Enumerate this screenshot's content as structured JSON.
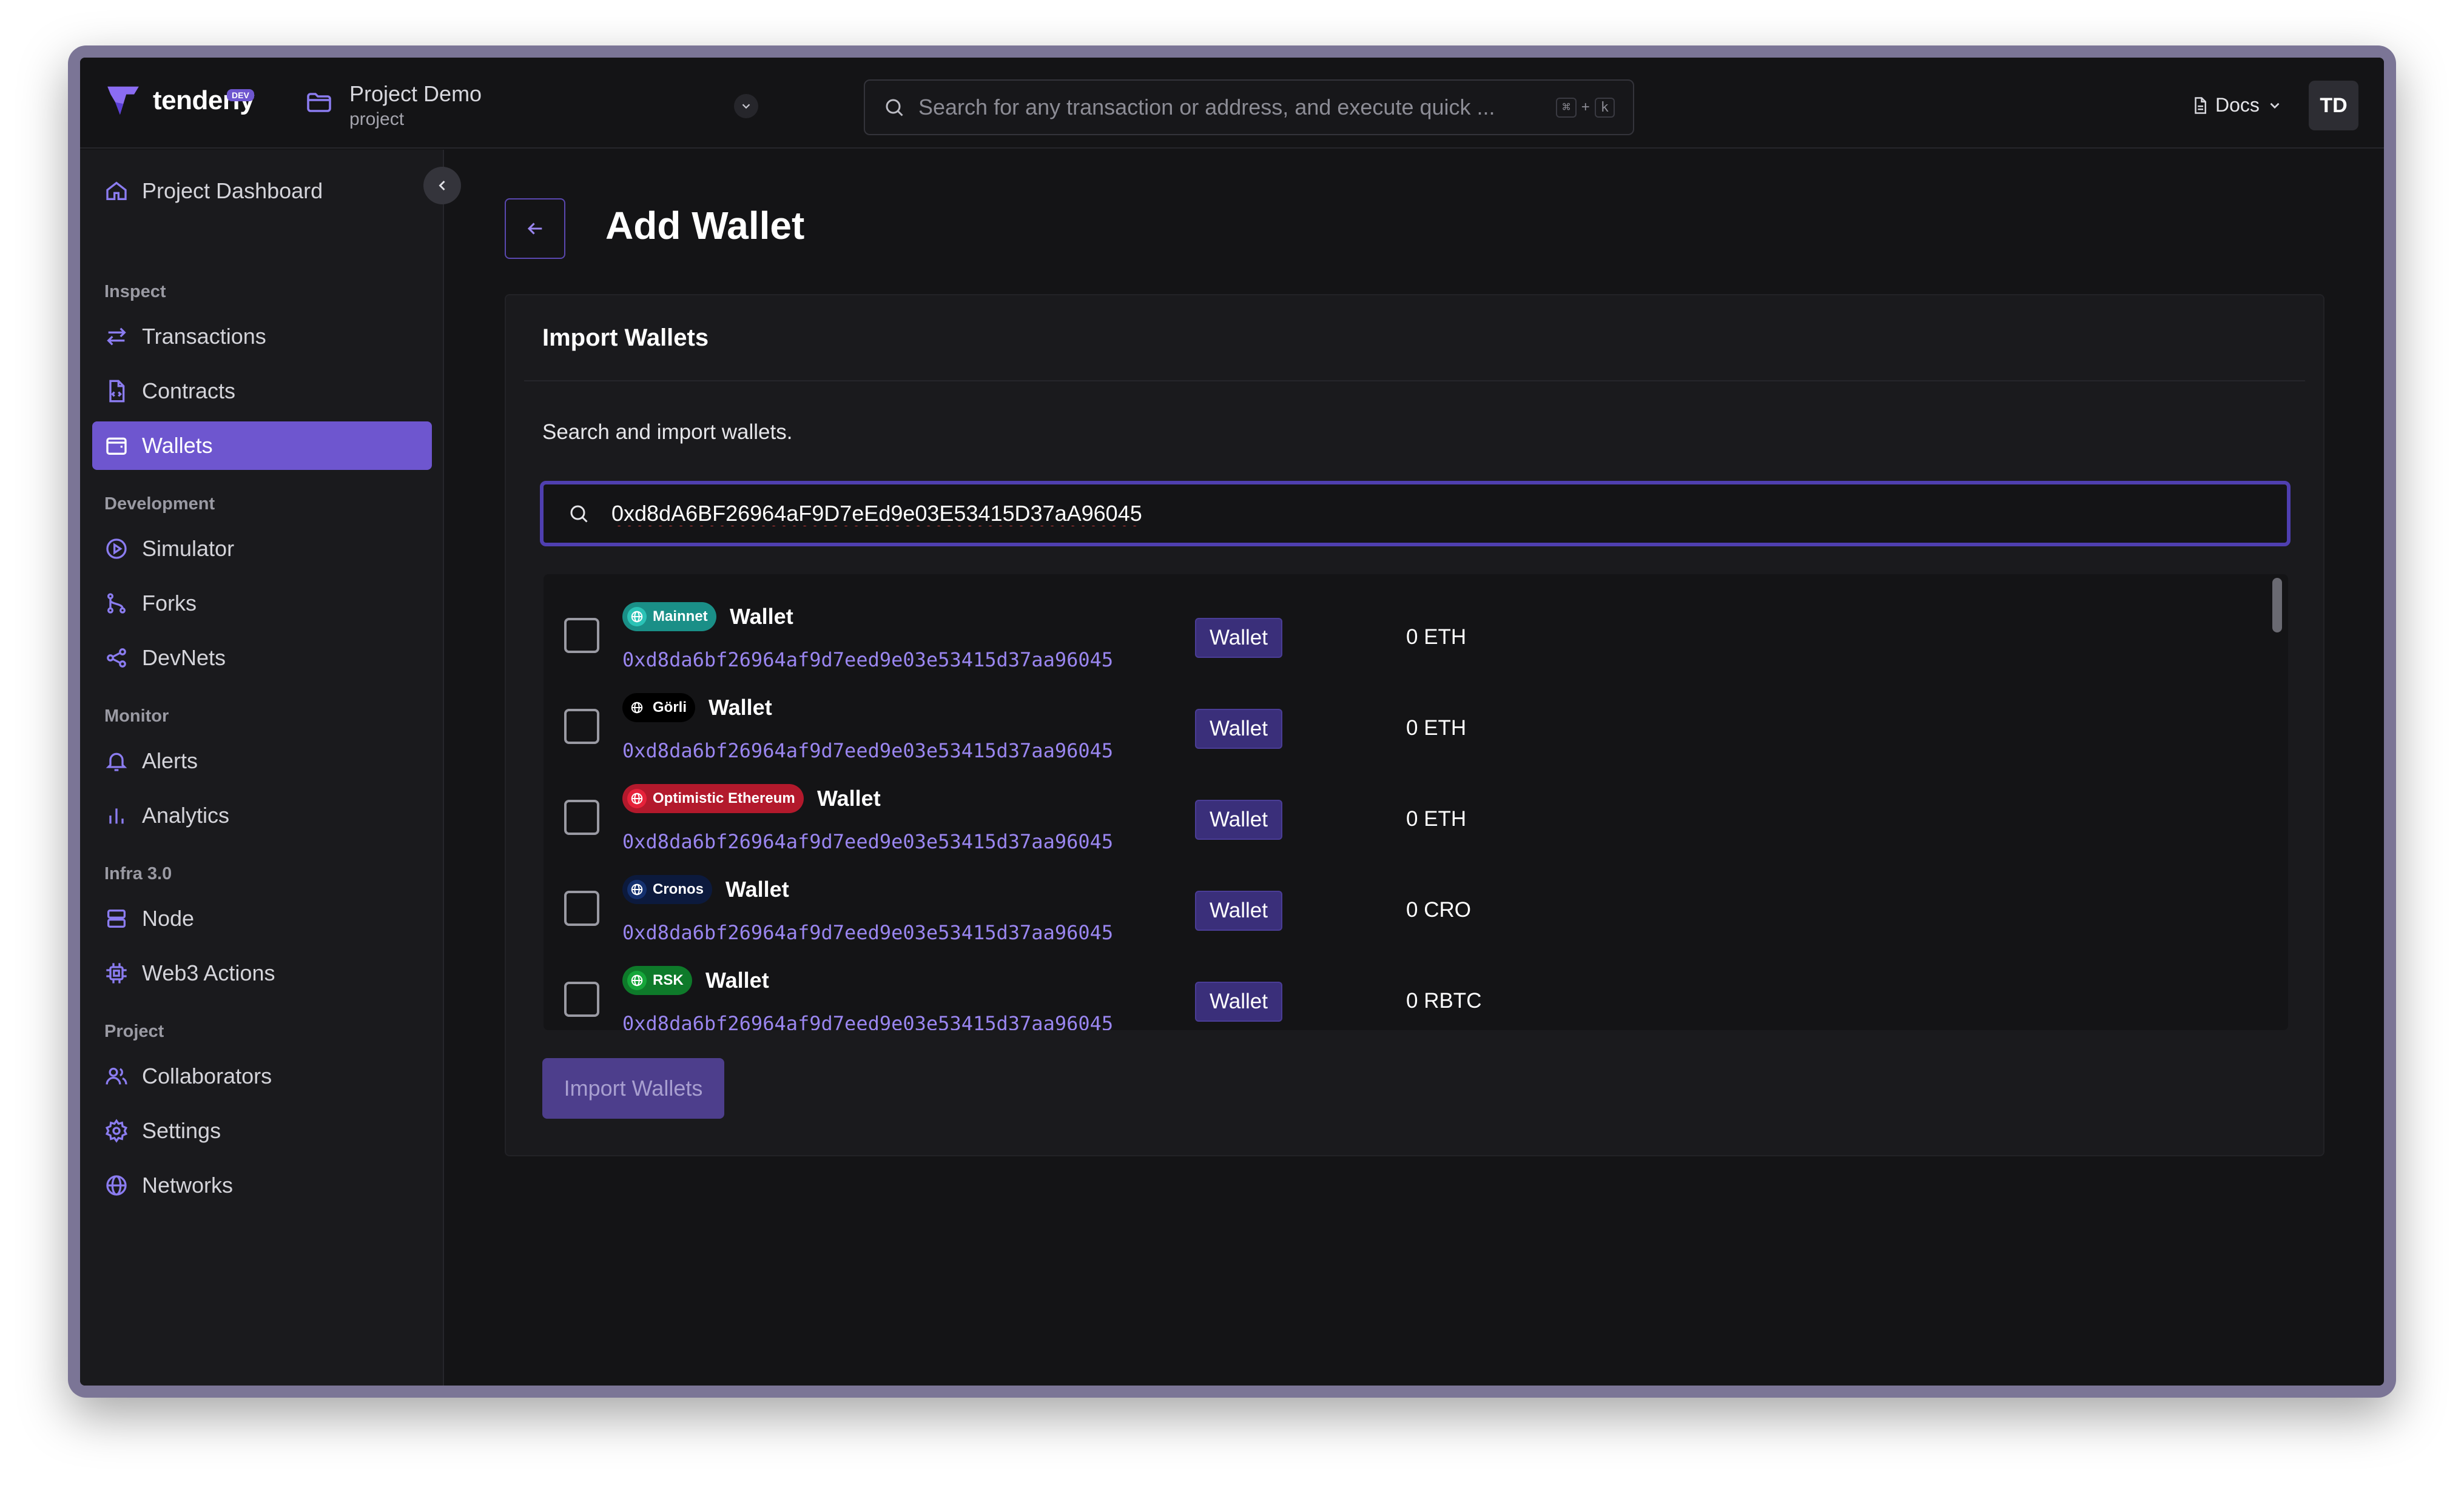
{
  "brand": {
    "name": "tenderly",
    "badge": "DEV"
  },
  "project": {
    "name": "Project Demo",
    "type": "project"
  },
  "search": {
    "placeholder": "Search for any transaction or address, and execute quick ...",
    "shortcut_key1": "⌘",
    "shortcut_plus": "+",
    "shortcut_key2": "k"
  },
  "header": {
    "docs_label": "Docs",
    "avatar_initials": "TD"
  },
  "sidebar": {
    "dashboard": "Project Dashboard",
    "sections": {
      "inspect": "Inspect",
      "development": "Development",
      "monitor": "Monitor",
      "infra": "Infra 3.0",
      "project": "Project"
    },
    "items": {
      "transactions": "Transactions",
      "contracts": "Contracts",
      "wallets": "Wallets",
      "simulator": "Simulator",
      "forks": "Forks",
      "devnets": "DevNets",
      "alerts": "Alerts",
      "analytics": "Analytics",
      "node": "Node",
      "web3actions": "Web3 Actions",
      "collaborators": "Collaborators",
      "settings": "Settings",
      "networks": "Networks"
    }
  },
  "main": {
    "title": "Add Wallet",
    "card_title": "Import Wallets",
    "description": "Search and import wallets.",
    "search_value": "0xd8dA6BF26964aF9D7eEd9e03E53415D37aA96045",
    "import_button": "Import Wallets",
    "wallets": [
      {
        "network": "Mainnet",
        "network_color": "#1a8f87",
        "globe_color": "#2bc3b6",
        "name": "Wallet",
        "address": "0xd8da6bf26964af9d7eed9e03e53415d37aa96045",
        "type": "Wallet",
        "balance": "0 ETH"
      },
      {
        "network": "Görli",
        "network_color": "#000000",
        "globe_color": "#000000",
        "name": "Wallet",
        "address": "0xd8da6bf26964af9d7eed9e03e53415d37aa96045",
        "type": "Wallet",
        "balance": "0 ETH"
      },
      {
        "network": "Optimistic Ethereum",
        "network_color": "#b3192c",
        "globe_color": "#e6223a",
        "name": "Wallet",
        "address": "0xd8da6bf26964af9d7eed9e03e53415d37aa96045",
        "type": "Wallet",
        "balance": "0 ETH"
      },
      {
        "network": "Cronos",
        "network_color": "#0c1a3d",
        "globe_color": "#14306e",
        "name": "Wallet",
        "address": "0xd8da6bf26964af9d7eed9e03e53415d37aa96045",
        "type": "Wallet",
        "balance": "0 CRO"
      },
      {
        "network": "RSK",
        "network_color": "#0e7a2a",
        "globe_color": "#15a63a",
        "name": "Wallet",
        "address": "0xd8da6bf26964af9d7eed9e03e53415d37aa96045",
        "type": "Wallet",
        "balance": "0 RBTC"
      }
    ]
  },
  "colors": {
    "accent": "#6e56cf",
    "background": "#141416",
    "sidebar": "#1a1a1d",
    "address": "#9a86f0"
  }
}
